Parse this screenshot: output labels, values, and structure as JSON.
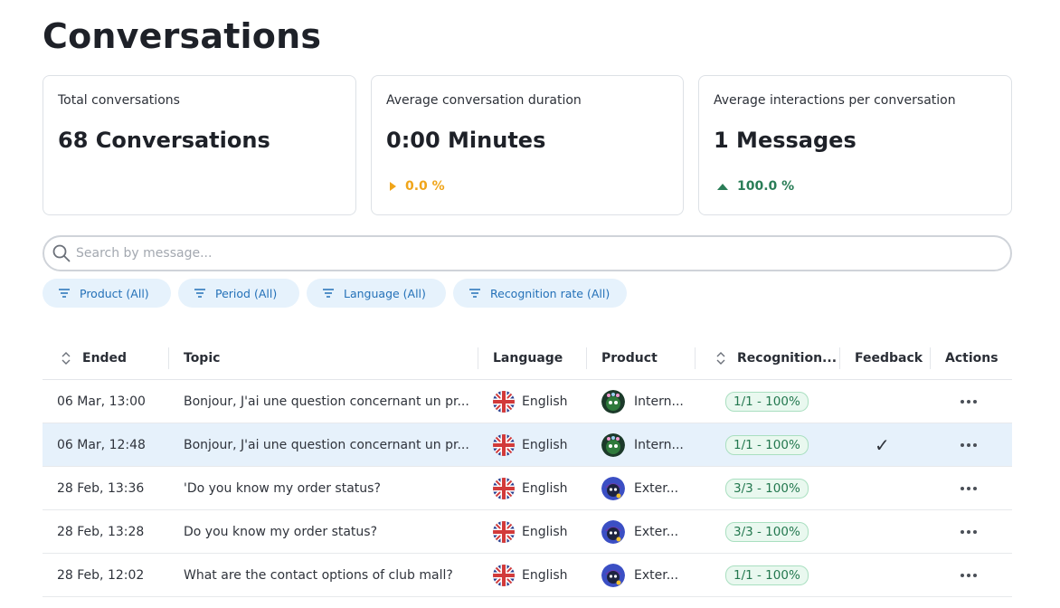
{
  "page": {
    "title": "Conversations"
  },
  "stats": [
    {
      "label": "Total conversations",
      "value": "68 Conversations",
      "trend": ""
    },
    {
      "label": "Average conversation duration",
      "value": "0:00 Minutes",
      "trend": "0.0 %",
      "trend_direction": "flat",
      "trend_color": "#f0a51a"
    },
    {
      "label": "Average interactions per conversation",
      "value": "1 Messages",
      "trend": "100.0 %",
      "trend_direction": "up",
      "trend_color": "#2a7d57"
    }
  ],
  "search": {
    "placeholder": "Search by message...",
    "value": ""
  },
  "filters": [
    {
      "label": "Product (All)"
    },
    {
      "label": "Period (All)"
    },
    {
      "label": "Language (All)"
    },
    {
      "label": "Recognition rate (All)"
    }
  ],
  "table": {
    "columns": [
      "Ended",
      "Topic",
      "Language",
      "Product",
      "Recognition...",
      "Feedback",
      "Actions"
    ],
    "rows": [
      {
        "ended": "06 Mar, 13:00",
        "topic": "Bonjour, J'ai une question concernant un pr...",
        "language": "English",
        "product": "Intern...",
        "recognition": "1/1 - 100%",
        "feedback": "",
        "selected": false
      },
      {
        "ended": "06 Mar, 12:48",
        "topic": "Bonjour, J'ai une question concernant un pr...",
        "language": "English",
        "product": "Intern...",
        "recognition": "1/1 - 100%",
        "feedback": "✓",
        "selected": true
      },
      {
        "ended": "28 Feb, 13:36",
        "topic": "'Do you know my order status?",
        "language": "English",
        "product": "Exter...",
        "recognition": "3/3 - 100%",
        "feedback": "",
        "selected": false
      },
      {
        "ended": "28 Feb, 13:28",
        "topic": "Do you know my order status?",
        "language": "English",
        "product": "Exter...",
        "recognition": "3/3 - 100%",
        "feedback": "",
        "selected": false
      },
      {
        "ended": "28 Feb, 12:02",
        "topic": "What are the contact options of club mall?",
        "language": "English",
        "product": "Exter...",
        "recognition": "1/1 - 100%",
        "feedback": "",
        "selected": false
      }
    ]
  },
  "colors": {
    "accent": "#2471b8",
    "chip_bg": "#e6f2fc",
    "selected_row": "#e6f1fb",
    "badge_green": "#23784f"
  }
}
